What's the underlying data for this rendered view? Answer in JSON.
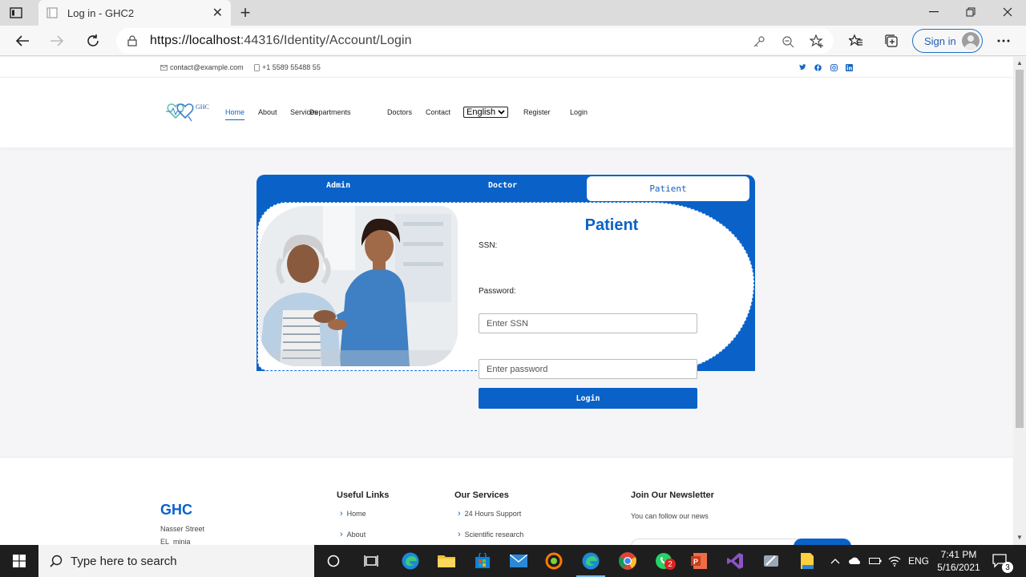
{
  "browser": {
    "tab_title": "Log in - GHC2",
    "url_host": "https://localhost",
    "url_rest": ":44316/Identity/Account/Login",
    "sign_in_label": "Sign in"
  },
  "topbar": {
    "email": "contact@example.com",
    "phone": "+1 5589 55488 55",
    "social": [
      "twitter-icon",
      "facebook-icon",
      "instagram-icon",
      "linkedin-icon"
    ]
  },
  "header": {
    "logo_text": "GHC",
    "nav": [
      {
        "label": "Home",
        "active": true
      },
      {
        "label": "About"
      },
      {
        "label": "Services"
      },
      {
        "label": "Departments"
      },
      {
        "label": "Doctors"
      },
      {
        "label": "Contact"
      }
    ],
    "language": "English",
    "register_label": "Register",
    "login_label": "Login"
  },
  "login": {
    "tabs": [
      "Admin",
      "Doctor",
      "Patient"
    ],
    "active_tab": "Patient",
    "title": "Patient",
    "ssn_label": "SSN:",
    "ssn_placeholder": "Enter SSN",
    "password_label": "Password:",
    "password_placeholder": "Enter password",
    "submit_label": "Login"
  },
  "footer": {
    "brand": "GHC",
    "address_line1": "Nasser Street",
    "address_line2": "EL_minia",
    "useful_links_title": "Useful Links",
    "useful_links": [
      "Home",
      "About"
    ],
    "services_title": "Our Services",
    "services": [
      "24 Hours Support",
      "Scientific research"
    ],
    "newsletter_title": "Join Our Newsletter",
    "newsletter_text": "You can follow our news"
  },
  "taskbar": {
    "search_placeholder": "Type here to search",
    "language": "ENG",
    "time": "7:41 PM",
    "date": "5/16/2021",
    "notification_count": "3",
    "whatsapp_badge": "2"
  },
  "colors": {
    "brand_blue": "#0a62c8",
    "nav_active": "#1565c0",
    "taskbar": "#1e1e1e"
  }
}
